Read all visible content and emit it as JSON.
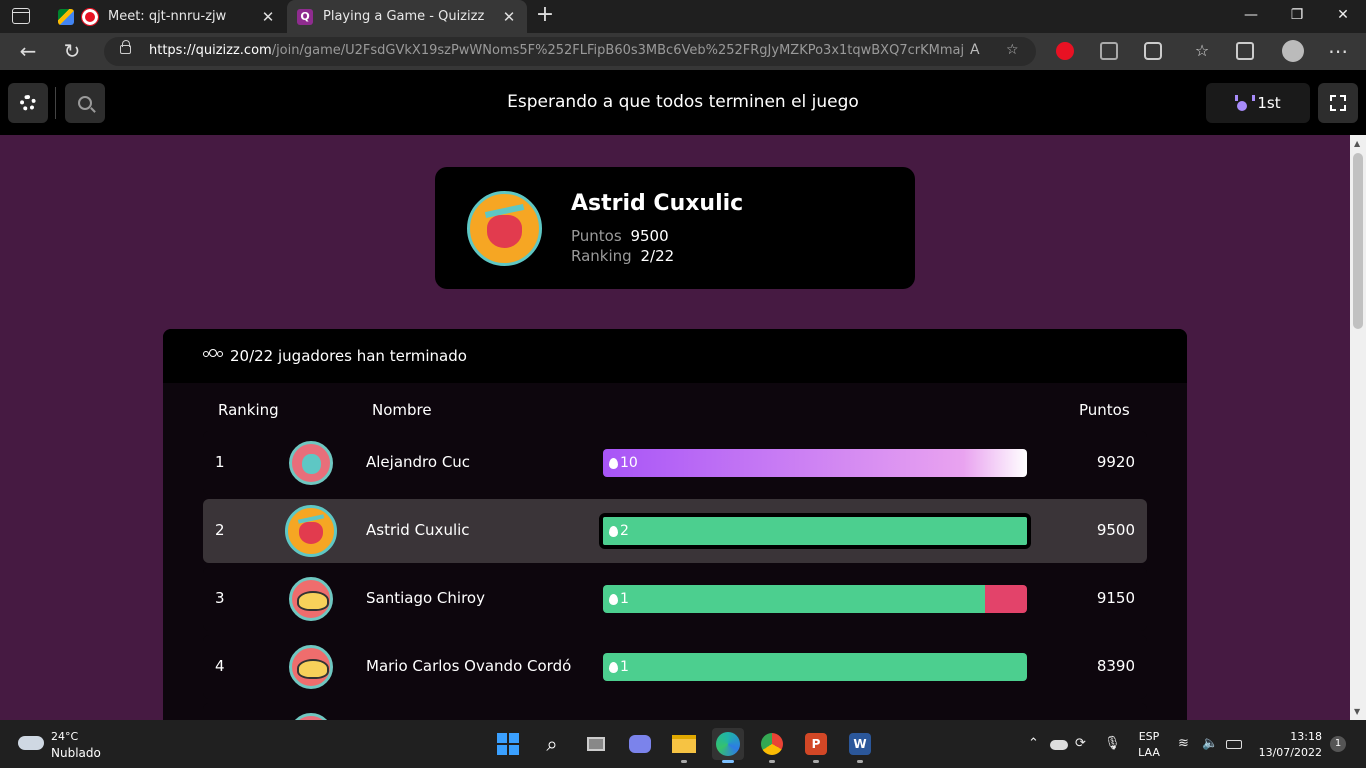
{
  "browser": {
    "tabs": [
      {
        "title": "Meet: qjt-nnru-zjw",
        "active": false
      },
      {
        "title": "Playing a Game - Quizizz",
        "active": true
      }
    ],
    "url_host": "https://quizizz.com",
    "url_path": "/join/game/U2FsdGVkX19szPwWNoms5F%252FLFipB60s3MBc6Veb%252FRgJyMZKPo3x1tqwBXQ7crKMmajvA..."
  },
  "header": {
    "title": "Esperando a que todos terminen el juego",
    "rank_badge": "1st"
  },
  "player": {
    "name": "Astrid Cuxulic",
    "points_label": "Puntos",
    "points": "9500",
    "ranking_label": "Ranking",
    "ranking": "2/22"
  },
  "leaderboard": {
    "finished_text": "20/22 jugadores han terminado",
    "col_ranking": "Ranking",
    "col_name": "Nombre",
    "col_points": "Puntos",
    "rows": [
      {
        "rank": "1",
        "name": "Alejandro Cuc",
        "streak": "10",
        "points": "9920",
        "correct_fraction": 1.0,
        "avatar": "cat"
      },
      {
        "rank": "2",
        "name": "Astrid Cuxulic",
        "streak": "2",
        "points": "9500",
        "correct_fraction": 1.0,
        "avatar": "sloth"
      },
      {
        "rank": "3",
        "name": "Santiago Chiroy",
        "streak": "1",
        "points": "9150",
        "correct_fraction": 0.9,
        "avatar": "taco"
      },
      {
        "rank": "4",
        "name": "Mario Carlos Ovando Cordó",
        "streak": "1",
        "points": "8390",
        "correct_fraction": 1.0,
        "avatar": "taco"
      }
    ]
  },
  "colors": {
    "background": "#461a42",
    "correct": "#4ccf8f",
    "wrong": "#e3436a",
    "top_player_bar_start": "#a855f7",
    "top_player_bar_end": "#ffffff"
  },
  "taskbar": {
    "temperature": "24°C",
    "weather": "Nublado",
    "language_1": "ESP",
    "language_2": "LAA",
    "time": "13:18",
    "date": "13/07/2022",
    "notifications": "1"
  }
}
